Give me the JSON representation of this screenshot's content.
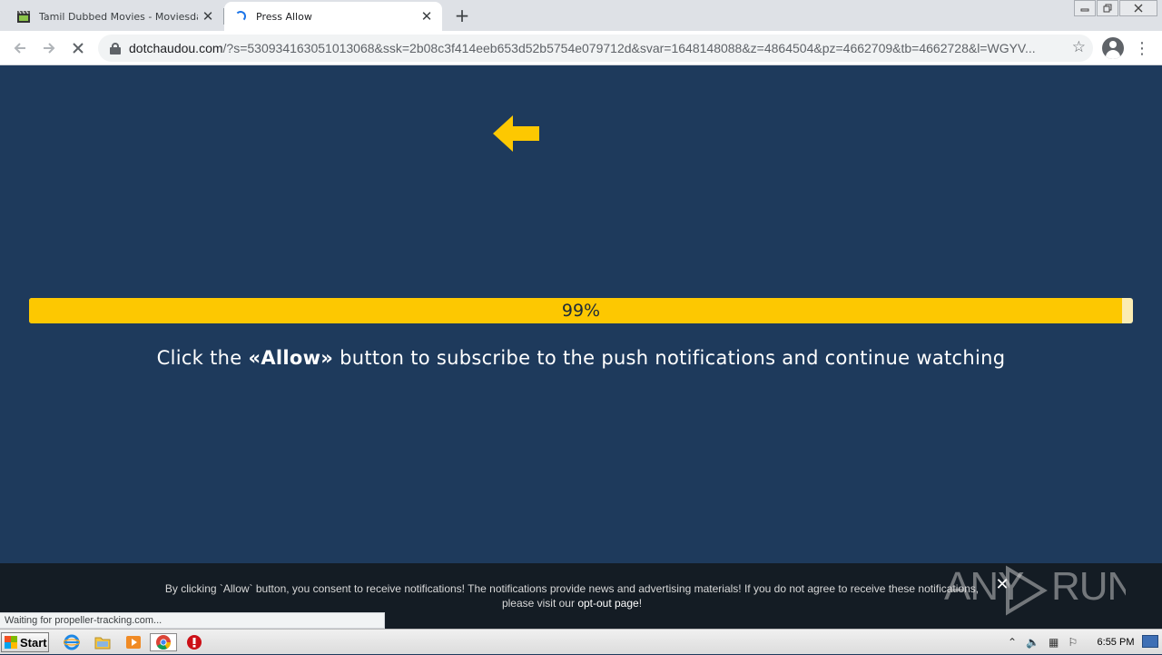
{
  "browser": {
    "tabs": [
      {
        "title": "Tamil Dubbed Movies - Moviesda",
        "active": false,
        "icon": "clapperboard-icon"
      },
      {
        "title": "Press Allow",
        "active": true,
        "icon": "loading-spinner-icon"
      }
    ],
    "url_host": "dotchaudou.com",
    "url_rest": "/?s=530934163051013068&ssk=2b08c3f414eeb653d52b5754e079712d&svar=1648148088&z=4864504&pz=4662709&tb=4662728&l=WGYV...",
    "status_text": "Waiting for propeller-tracking.com..."
  },
  "page": {
    "progress": {
      "value": 0.99,
      "label": "99%"
    },
    "headline_pre": "Click the ",
    "headline_bold": "«Allow»",
    "headline_post": " button to subscribe to the push notifications and continue watching"
  },
  "consent": {
    "line1": "By clicking `Allow` button, you consent to receive notifications! The notifications provide news and advertising materials! If you do not agree to receive these notifications,",
    "line2_pre": "please visit our ",
    "link": "opt-out page",
    "line2_post": "!",
    "close": "✕"
  },
  "watermark": "ANY RUN",
  "taskbar": {
    "start_label": "Start",
    "clock": "6:55 PM"
  },
  "colors": {
    "page_bg": "#1e3a5c",
    "accent": "#fdc801",
    "progress_track": "#fbecb2"
  }
}
